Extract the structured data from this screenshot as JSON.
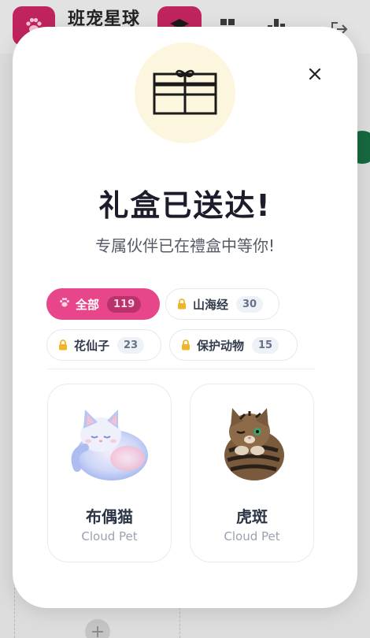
{
  "app": {
    "title": "班宠星球"
  },
  "modal": {
    "title": "礼盒已送达!",
    "subtitle": "专属伙伴已在禮盒中等你!",
    "close_icon": "close-icon",
    "gift_icon": "gift-box-icon"
  },
  "filters": [
    {
      "label": "全部",
      "count": "119",
      "active": true,
      "icon": "paw-icon"
    },
    {
      "label": "山海经",
      "count": "30",
      "active": false,
      "icon": "lock-icon"
    },
    {
      "label": "花仙子",
      "count": "23",
      "active": false,
      "icon": "lock-icon"
    },
    {
      "label": "保护动物",
      "count": "15",
      "active": false,
      "icon": "lock-icon"
    }
  ],
  "pets": [
    {
      "name": "布偶猫",
      "subtitle": "Cloud Pet",
      "art": "ragdoll-cat-illustration"
    },
    {
      "name": "虎斑",
      "subtitle": "Cloud Pet",
      "art": "tabby-cat-illustration"
    }
  ],
  "colors": {
    "accent": "#e8468a",
    "gift_circle": "#fdf6df",
    "lock": "#f0b429"
  }
}
